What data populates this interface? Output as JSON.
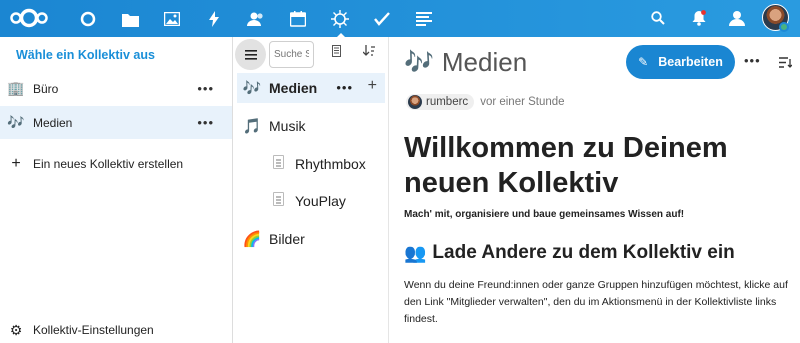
{
  "header": {
    "apps": [
      "dashboard-icon",
      "files-icon",
      "photos-icon",
      "activity-icon",
      "contacts-icon",
      "calendar-icon",
      "collectives-icon",
      "tasks-icon",
      "notes-icon"
    ],
    "active_app": "collectives-icon",
    "right_icons": [
      "search-icon",
      "notifications-icon",
      "contacts-menu-icon"
    ],
    "accent_color": "#1a8fd8"
  },
  "nav": {
    "heading": "Wähle ein Kollektiv aus",
    "items": [
      {
        "emoji": "🏢",
        "label": "Büro"
      },
      {
        "emoji": "🎶",
        "label": "Medien"
      }
    ],
    "new_label": "Ein neues Kollektiv erstellen",
    "settings_label": "Kollektiv-Einstellungen"
  },
  "pages": {
    "search_placeholder": "Suche S...",
    "items": [
      {
        "emoji": "🎶",
        "label": "Medien"
      },
      {
        "emoji": "🎵",
        "label": "Musik"
      },
      {
        "label": "Rhythmbox"
      },
      {
        "label": "YouPlay"
      },
      {
        "emoji": "🌈",
        "label": "Bilder"
      }
    ]
  },
  "main": {
    "title_emoji": "🎶",
    "title": "Medien",
    "edit_label": "Bearbeiten",
    "user": "rumberc",
    "time": "vor einer Stunde",
    "heading": "Willkommen zu Deinem neuen Kollektiv",
    "lead": "Mach' mit, organisiere und baue gemeinsames Wissen auf!",
    "h2_emoji": "👥",
    "h2": "Lade Andere zu dem Kollektiv ein",
    "paragraph": "Wenn du deine Freund:innen oder ganze Gruppen hinzufügen möchtest, klicke auf den Link \"Mitglieder verwalten\", den du im Aktionsmenü in der Kollektivliste links findest."
  }
}
